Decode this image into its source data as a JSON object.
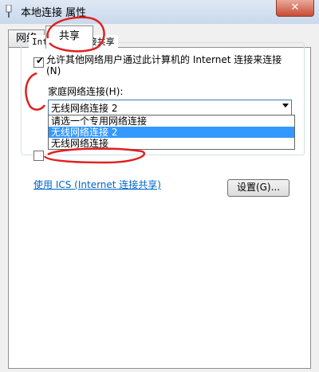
{
  "window": {
    "title": "本地连接 属性",
    "close_label": "✕"
  },
  "tabs": [
    {
      "label": "网络"
    },
    {
      "label": "共享"
    }
  ],
  "sharing": {
    "group_title": "Internet 连接共享",
    "allow_label": "允许其他网络用户通过此计算机的 Internet 连接来连接(N)",
    "allow_checked": true,
    "home_network_label": "家庭网络连接(H):",
    "selected_connection": "无线网络连接 2",
    "dropdown_options": [
      "请选一个专用网络连接",
      "无线网络连接 2",
      "无线网络连接"
    ],
    "highlighted_option_index": 1,
    "ics_link": "使用 ICS (Internet 连接共享)",
    "settings_button": "设置(G)..."
  },
  "colors": {
    "annotation": "#e02020",
    "selection": "#3399ff",
    "link": "#0066cc"
  }
}
